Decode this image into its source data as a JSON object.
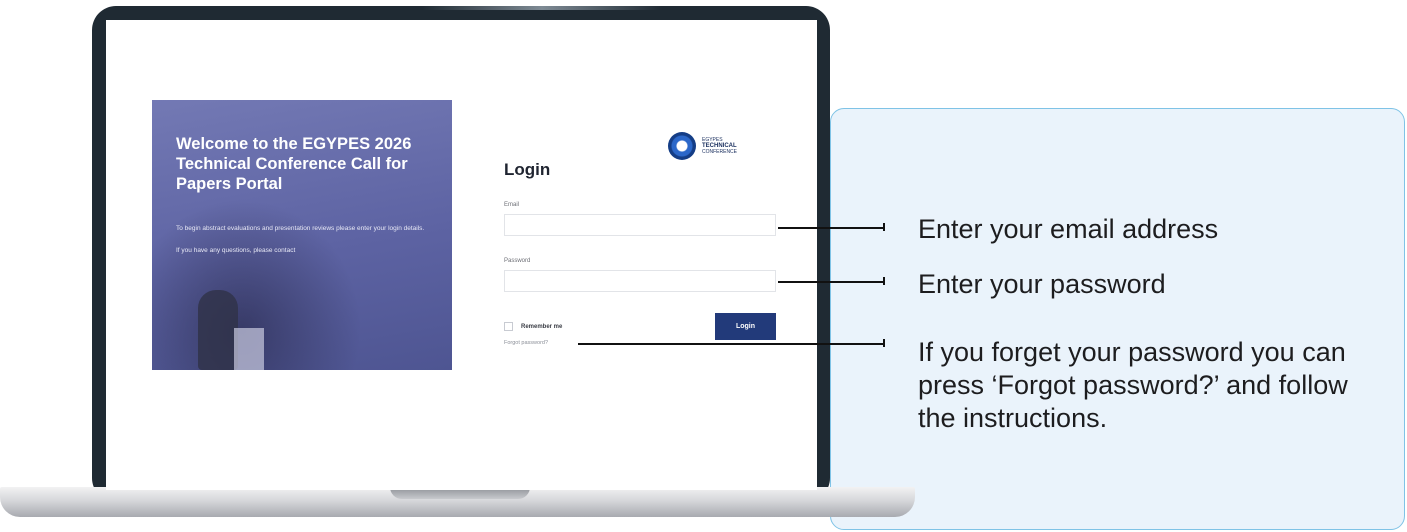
{
  "welcome": {
    "title": "Welcome to the EGYPES 2026 Technical Conference Call for Papers Portal",
    "intro": "To begin abstract evaluations and presentation reviews please enter your login details.",
    "contact": "If you have any questions, please contact"
  },
  "logo": {
    "line1": "EGYPES",
    "line2": "TECHNICAL",
    "line3": "CONFERENCE"
  },
  "login": {
    "heading": "Login",
    "email_label": "Email",
    "email_value": "",
    "password_label": "Password",
    "password_value": "",
    "remember_label": "Remember me",
    "forgot_label": "Forgot password?",
    "button_label": "Login"
  },
  "callouts": {
    "email": "Enter your email address",
    "password": "Enter your password",
    "forgot": "If you forget your password you can press ‘Forgot password?’ and follow the instructions."
  },
  "colors": {
    "callout_panel_bg": "#eaf3fb",
    "callout_panel_border": "#7fc3e6",
    "login_button": "#223a7a",
    "hero_overlay": "#5d63a3"
  }
}
